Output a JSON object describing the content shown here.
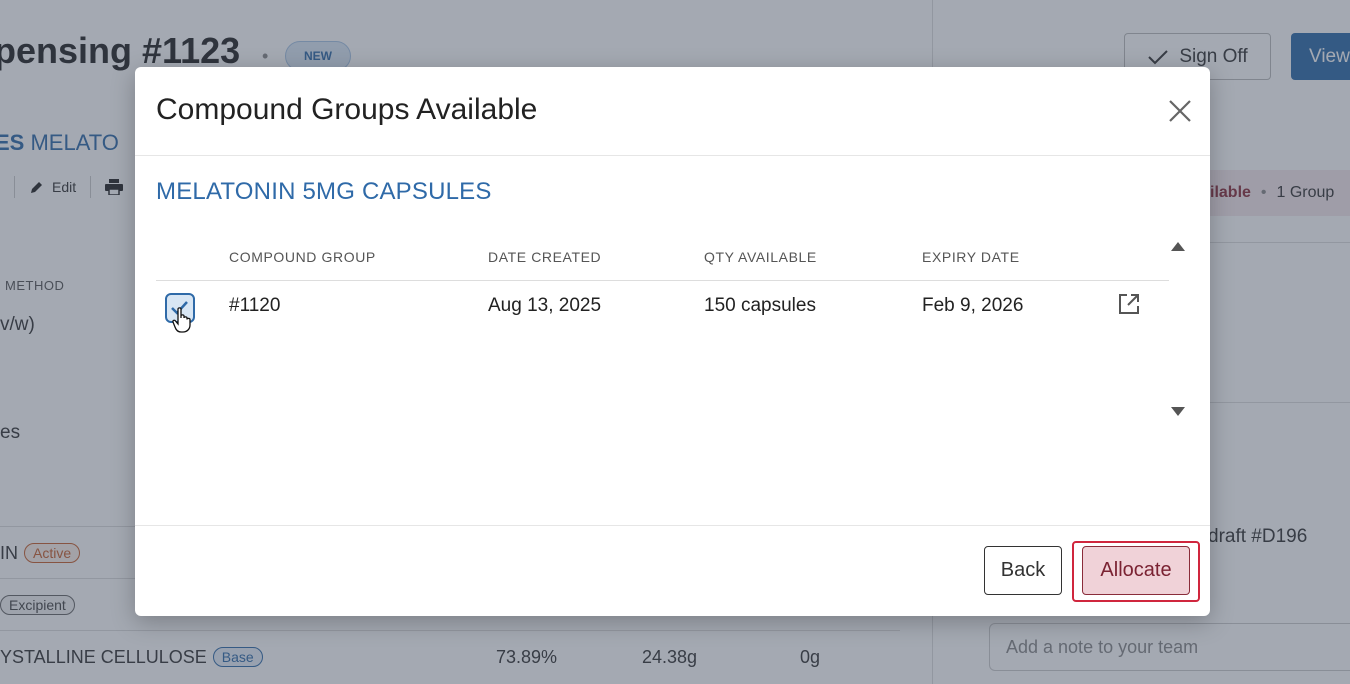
{
  "page": {
    "title": "pensing #1123",
    "badge": "NEW",
    "sign_off_label": "Sign Off",
    "view_label": "View",
    "subtitle_bold": "ES",
    "subtitle_rest": " MELATO",
    "toolbar_edit": "Edit",
    "method_label": "METHOD",
    "method_value": "v/w)",
    "es_value": "es",
    "ingredients": [
      {
        "name": "IN",
        "badge": "Active",
        "pct": "",
        "qty": "",
        "alloc": ""
      },
      {
        "name": "",
        "badge": "Excipient",
        "pct": "",
        "qty": "",
        "alloc": ""
      },
      {
        "name": "YSTALLINE CELLULOSE",
        "badge": "Base",
        "pct": "73.89%",
        "qty": "24.38g",
        "alloc": "0g"
      }
    ],
    "availability_status": "ilable",
    "availability_groups": "1 Group",
    "draft_text": "draft #D196",
    "note_placeholder": "Add a note to your team"
  },
  "modal": {
    "title": "Compound Groups Available",
    "product": "MELATONIN 5MG CAPSULES",
    "columns": [
      "COMPOUND GROUP",
      "DATE CREATED",
      "QTY AVAILABLE",
      "EXPIRY DATE"
    ],
    "rows": [
      {
        "group": "#1120",
        "date_created": "Aug 13, 2025",
        "qty_available": "150 capsules",
        "expiry": "Feb 9, 2026",
        "checked": true
      }
    ],
    "back_label": "Back",
    "allocate_label": "Allocate"
  },
  "colors": {
    "accent_blue": "#2f6aa8",
    "allocate_bg": "#f0d2d8",
    "allocate_focus": "#d0263d",
    "overlay": "rgba(62,72,92,0.47)"
  },
  "icons": {
    "close": "close-icon",
    "checkbox": "checkmark-icon",
    "external": "external-link-icon",
    "cursor": "hand-pointer-icon"
  }
}
